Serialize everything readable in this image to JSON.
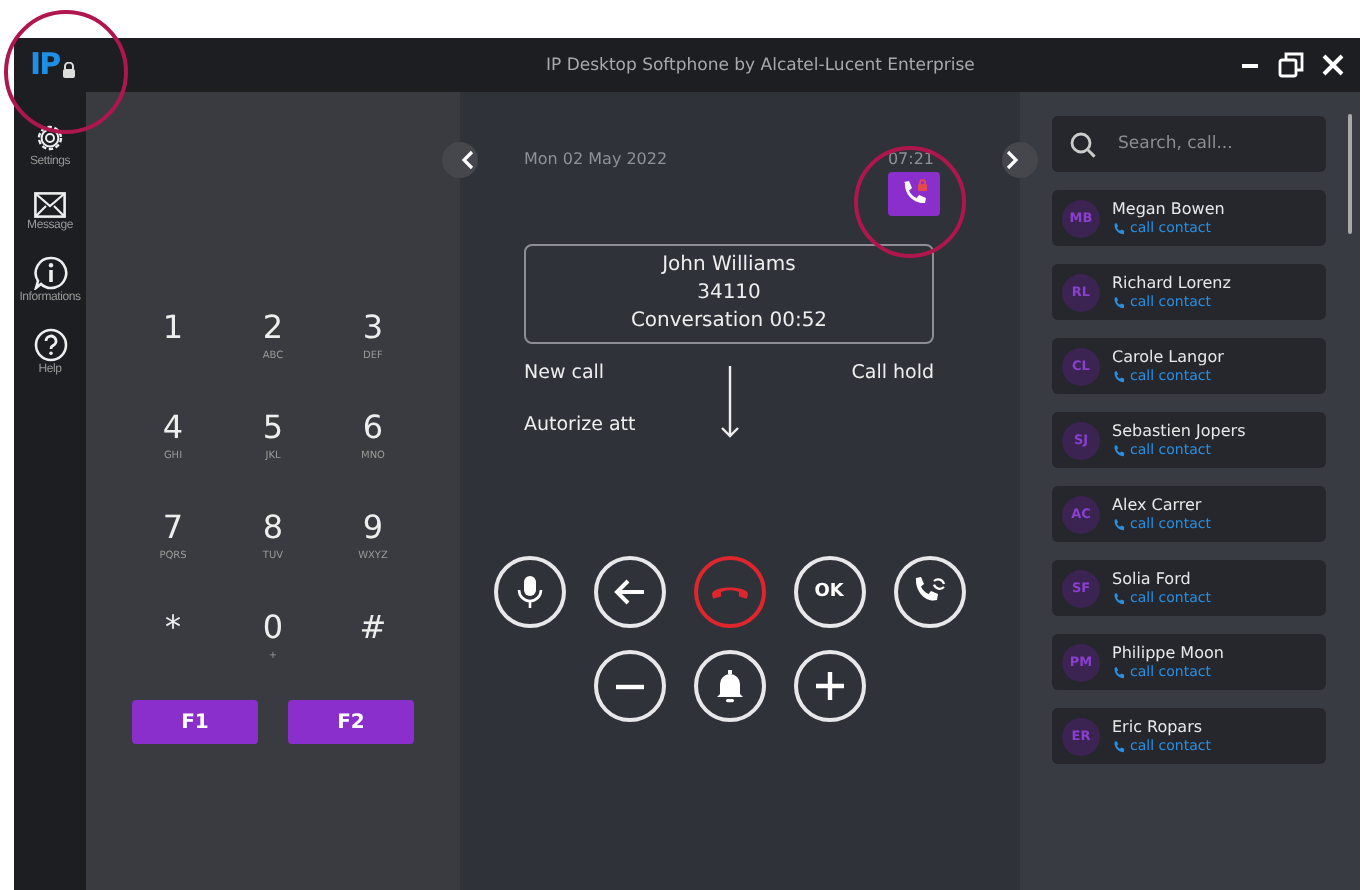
{
  "window": {
    "logo": "IP",
    "title": "IP Desktop Softphone by Alcatel-Lucent Enterprise"
  },
  "nav": [
    {
      "kind": "settings",
      "label": "Settings"
    },
    {
      "kind": "message",
      "label": "Message"
    },
    {
      "kind": "info",
      "label": "Informations"
    },
    {
      "kind": "help",
      "label": "Help"
    }
  ],
  "keypad": {
    "keys": [
      {
        "digit": "1"
      },
      {
        "digit": "2",
        "letters": "ABC"
      },
      {
        "digit": "3",
        "letters": "DEF"
      },
      {
        "digit": "4",
        "letters": "GHI"
      },
      {
        "digit": "5",
        "letters": "JKL"
      },
      {
        "digit": "6",
        "letters": "MNO"
      },
      {
        "digit": "7",
        "letters": "PQRS"
      },
      {
        "digit": "8",
        "letters": "TUV"
      },
      {
        "digit": "9",
        "letters": "WXYZ"
      },
      {
        "digit": "*"
      },
      {
        "digit": "0",
        "letters": "+"
      },
      {
        "digit": "#"
      }
    ],
    "function_keys": [
      "F1",
      "F2"
    ]
  },
  "call": {
    "date": "Mon 02 May 2022",
    "time": "07:21",
    "name": "John Williams",
    "number": "34110",
    "status": "Conversation 00:52",
    "action_columns": [
      [
        "New call",
        "Autorize att"
      ],
      [
        "Call hold"
      ]
    ],
    "controls": [
      [
        {
          "kind": "mic"
        },
        {
          "kind": "back"
        },
        {
          "kind": "hangup"
        },
        {
          "kind": "ok",
          "label": "OK"
        },
        {
          "kind": "transfer"
        }
      ],
      [
        {
          "kind": "minus"
        },
        {
          "kind": "bell"
        },
        {
          "kind": "plus"
        }
      ]
    ]
  },
  "search": {
    "placeholder": "Search, call..."
  },
  "contacts": [
    {
      "initials": "MB",
      "name": "Megan Bowen",
      "action": "call contact"
    },
    {
      "initials": "RL",
      "name": "Richard Lorenz",
      "action": "call contact"
    },
    {
      "initials": "CL",
      "name": "Carole Langor",
      "action": "call contact"
    },
    {
      "initials": "SJ",
      "name": "Sebastien Jopers",
      "action": "call contact"
    },
    {
      "initials": "AC",
      "name": "Alex Carrer",
      "action": "call contact"
    },
    {
      "initials": "SF",
      "name": "Solia Ford",
      "action": "call contact"
    },
    {
      "initials": "PM",
      "name": "Philippe Moon",
      "action": "call contact"
    },
    {
      "initials": "ER",
      "name": "Eric Ropars",
      "action": "call contact"
    }
  ]
}
